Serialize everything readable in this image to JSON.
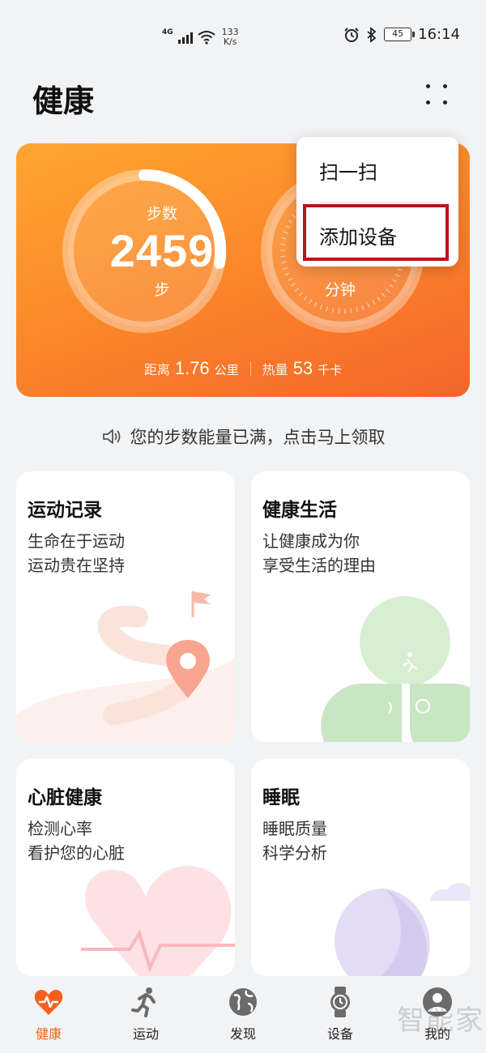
{
  "status_bar": {
    "network": "4G",
    "speed_value": "133",
    "speed_unit": "K/s",
    "battery": "45",
    "time": "16:14"
  },
  "header": {
    "title": "健康",
    "more_icon": "grid-dots-icon"
  },
  "activity_card": {
    "steps_title": "步数",
    "steps_value": "2459",
    "steps_unit": "步",
    "minutes_unit": "分钟",
    "distance_label": "距离",
    "distance_value": "1.76",
    "distance_unit": "公里",
    "calorie_label": "热量",
    "calorie_value": "53",
    "calorie_unit": "千卡"
  },
  "popup_menu": {
    "items": [
      {
        "label": "扫一扫"
      },
      {
        "label": "添加设备"
      }
    ],
    "highlight_color": "#b3161b"
  },
  "notice": {
    "text": "您的步数能量已满，点击马上领取",
    "icon": "speaker-icon"
  },
  "cards": [
    {
      "title": "运动记录",
      "line1": "生命在于运动",
      "line2": "运动贵在坚持"
    },
    {
      "title": "健康生活",
      "line1": "让健康成为你",
      "line2": "享受生活的理由"
    },
    {
      "title": "心脏健康",
      "line1": "检测心率",
      "line2": "看护您的心脏"
    },
    {
      "title": "睡眠",
      "line1": "睡眠质量",
      "line2": "科学分析"
    }
  ],
  "bottom_nav": {
    "items": [
      {
        "label": "健康",
        "icon": "heart-pulse-icon",
        "active": true
      },
      {
        "label": "运动",
        "icon": "running-icon",
        "active": false
      },
      {
        "label": "发现",
        "icon": "globe-icon",
        "active": false
      },
      {
        "label": "设备",
        "icon": "watch-icon",
        "active": false
      },
      {
        "label": "我的",
        "icon": "avatar-icon",
        "active": false
      }
    ]
  },
  "watermark": "智能家",
  "colors": {
    "accent": "#f5611c",
    "card_orange": "#fb8a2a",
    "background": "#f2f3f5"
  }
}
